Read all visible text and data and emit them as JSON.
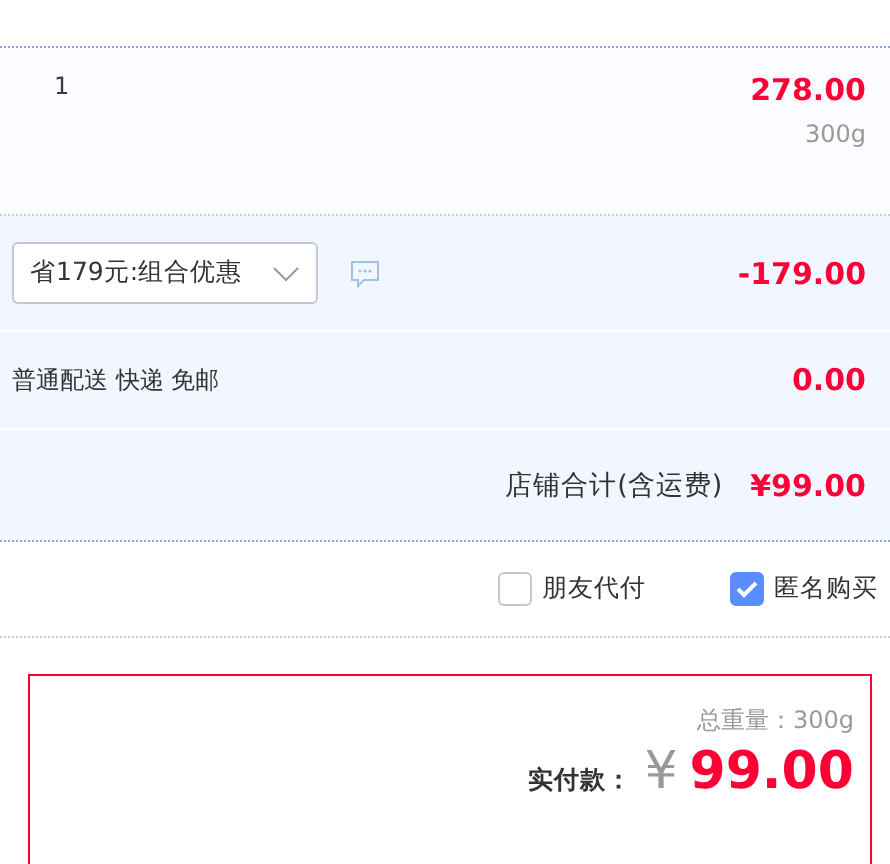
{
  "item": {
    "quantity": "1",
    "price": "278.00",
    "weight": "300g"
  },
  "promotion": {
    "selected_option": "省179元:组合优惠",
    "discount": "-179.00"
  },
  "shipping": {
    "label": "普通配送 快递 免邮",
    "fee": "0.00"
  },
  "shop_total": {
    "label": "店铺合计(含运费)",
    "amount": "¥99.00"
  },
  "options": [
    {
      "label": "朋友代付",
      "checked": false
    },
    {
      "label": "匿名购买",
      "checked": true
    }
  ],
  "summary": {
    "total_weight_label": "总重量：",
    "total_weight": "300g",
    "pay_label": "实付款：",
    "currency": "¥",
    "amount": "99.00"
  }
}
